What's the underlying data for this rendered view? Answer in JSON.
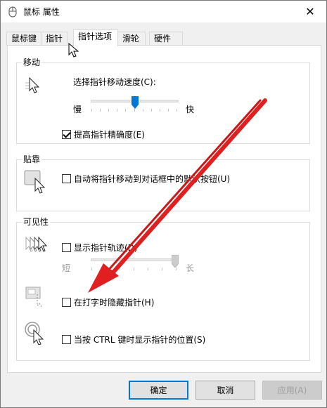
{
  "window": {
    "title": "鼠标 属性",
    "close_glyph": "✕"
  },
  "tabs": [
    {
      "label": "鼠标键"
    },
    {
      "label": "指针"
    },
    {
      "label": "指针选项"
    },
    {
      "label": "滑轮"
    },
    {
      "label": "硬件"
    }
  ],
  "motion": {
    "title": "移动",
    "speed_label": "选择指针移动速度(C):",
    "slow_label": "慢",
    "fast_label": "快",
    "speed_level": 0.5,
    "enhance_label": "提高指针精确度(E)",
    "enhance_checked": true
  },
  "snap": {
    "title": "贴靠",
    "label": "自动将指针移动到对话框中的默认按钮(U)",
    "checked": false
  },
  "visibility": {
    "title": "可见性",
    "trails_label": "显示指针轨迹(D)",
    "trails_checked": false,
    "short_label": "短",
    "long_label": "长",
    "trail_level": 1.0,
    "hide_label": "在打字时隐藏指针(H)",
    "hide_checked": false,
    "ctrl_label": "当按 CTRL 键时显示指针的位置(S)",
    "ctrl_checked": false
  },
  "buttons": {
    "ok": "确定",
    "cancel": "取消",
    "apply": "应用(A)"
  },
  "colors": {
    "accent": "#0078d7",
    "arrow": "#e02020"
  },
  "icons": {
    "title": "mouse-icon",
    "close": "close-icon"
  }
}
